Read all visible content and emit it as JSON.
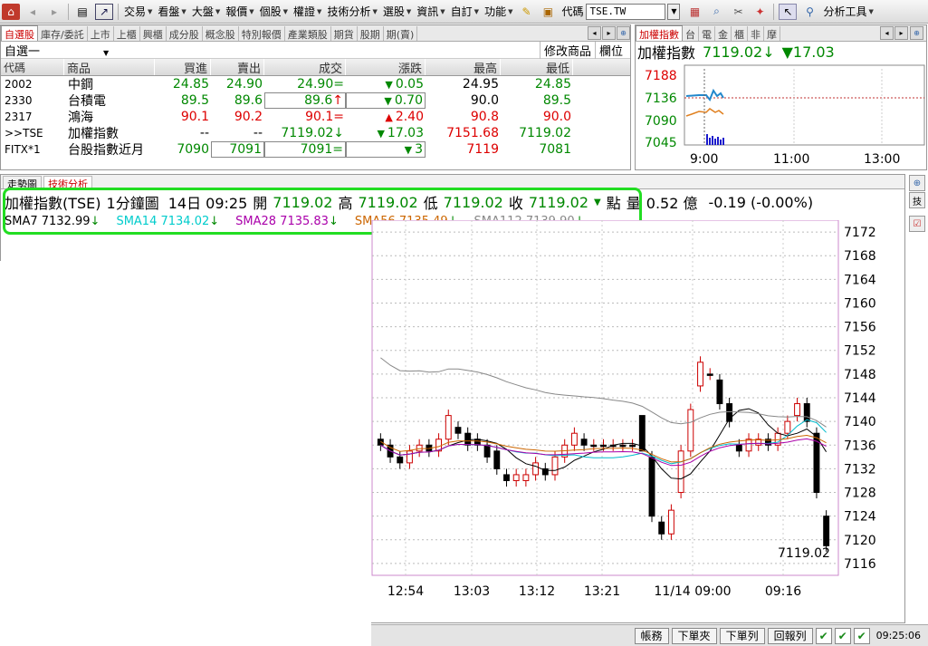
{
  "toolbar": {
    "menus": [
      "交易",
      "看盤",
      "大盤",
      "報價",
      "個股",
      "權證",
      "技術分析",
      "選股",
      "資訊",
      "自訂",
      "功能"
    ],
    "code_label": "代碼",
    "code_value": "TSE.TW",
    "analysis_tools": "分析工具"
  },
  "watchlist": {
    "tabs": [
      "自選股",
      "庫存/委託",
      "上市",
      "上櫃",
      "興櫃",
      "成分股",
      "概念股",
      "特別報價",
      "產業類股",
      "期貨",
      "股期",
      "期(賣)"
    ],
    "group_name": "自選一",
    "modify_label": "修改商品",
    "columns_label": "欄位",
    "headers": [
      "代碼",
      "商品",
      "買進",
      "賣出",
      "成交",
      "漲跌",
      "最高",
      "最低"
    ],
    "rows": [
      {
        "code": "2002",
        "name": "中鋼",
        "bid": "24.85",
        "ask": "24.90",
        "last": "24.90",
        "last_mark": "=",
        "chg": "0.05",
        "chg_dir": "down",
        "high": "24.95",
        "low": "24.85",
        "color": "green"
      },
      {
        "code": "2330",
        "name": "台積電",
        "bid": "89.5",
        "ask": "89.6",
        "last": "89.6",
        "last_mark": "↑",
        "chg": "0.70",
        "chg_dir": "down",
        "high": "90.0",
        "low": "89.5",
        "color": "green"
      },
      {
        "code": "2317",
        "name": "鴻海",
        "bid": "90.1",
        "ask": "90.2",
        "last": "90.1",
        "last_mark": "=",
        "chg": "2.40",
        "chg_dir": "up",
        "high": "90.8",
        "low": "90.0",
        "color": "red"
      },
      {
        "code": ">>TSE",
        "name": "加權指數",
        "bid": "--",
        "ask": "--",
        "last": "7119.02",
        "last_mark": "↓",
        "chg": "17.03",
        "chg_dir": "down",
        "high": "7151.68",
        "low": "7119.02",
        "color": "green"
      },
      {
        "code": "FITX*1",
        "name": "台股指數近月",
        "bid": "7090",
        "ask": "7091",
        "last": "7091",
        "last_mark": "=",
        "chg": "3",
        "chg_dir": "down",
        "high": "7119",
        "low": "7081",
        "color": "green"
      }
    ]
  },
  "mini_chart": {
    "tabs": [
      "加權指數",
      "台",
      "電",
      "金",
      "櫃",
      "非",
      "摩"
    ],
    "name": "加權指數",
    "value": "7119.02",
    "change": "17.03",
    "y_ticks": [
      "7188",
      "7136",
      "7090",
      "7045"
    ],
    "x_ticks": [
      "9:00",
      "11:00",
      "13:00"
    ]
  },
  "main_chart": {
    "tabs": [
      "走勢圖",
      "技術分析"
    ],
    "info": {
      "symbol": "加權指數(TSE)",
      "interval": "1分鐘圖",
      "date": "14日 09:25",
      "open_label": "開",
      "open": "7119.02",
      "high_label": "高",
      "high": "7119.02",
      "low_label": "低",
      "low": "7119.02",
      "close_label": "收",
      "close": "7119.02",
      "pts_label": "點",
      "volume_label": "量",
      "volume": "0.52 億",
      "change": "-0.19 (-0.00%)"
    },
    "ma": [
      {
        "label": "SMA7 7132.99",
        "color": "#000000"
      },
      {
        "label": "SMA14 7134.02",
        "color": "#00cccc"
      },
      {
        "label": "SMA28 7135.83",
        "color": "#aa00aa"
      },
      {
        "label": "SMA56 7135.49",
        "color": "#cc6600"
      },
      {
        "label": "SMA112 7139.90",
        "color": "#888888"
      }
    ],
    "last_price_label": "7119.02"
  },
  "chart_data": {
    "type": "candlestick",
    "y_ticks": [
      7172,
      7168,
      7164,
      7160,
      7156,
      7152,
      7148,
      7144,
      7140,
      7136,
      7132,
      7128,
      7124,
      7120,
      7116
    ],
    "ylim": [
      7114,
      7174
    ],
    "x_ticks": [
      "12:54",
      "13:03",
      "13:12",
      "13:21",
      "11/14 09:00",
      "09:16"
    ],
    "candles": [
      {
        "o": 7137,
        "c": 7136,
        "h": 7138,
        "l": 7135
      },
      {
        "o": 7136,
        "c": 7134,
        "h": 7137,
        "l": 7133
      },
      {
        "o": 7134,
        "c": 7133,
        "h": 7135,
        "l": 7132
      },
      {
        "o": 7133,
        "c": 7135,
        "h": 7136,
        "l": 7132
      },
      {
        "o": 7135,
        "c": 7136,
        "h": 7137,
        "l": 7134
      },
      {
        "o": 7136,
        "c": 7135,
        "h": 7137,
        "l": 7134
      },
      {
        "o": 7135,
        "c": 7137,
        "h": 7138,
        "l": 7134
      },
      {
        "o": 7137,
        "c": 7141,
        "h": 7142,
        "l": 7136
      },
      {
        "o": 7139,
        "c": 7138,
        "h": 7140,
        "l": 7137
      },
      {
        "o": 7138,
        "c": 7136,
        "h": 7139,
        "l": 7135
      },
      {
        "o": 7137,
        "c": 7136,
        "h": 7138,
        "l": 7135
      },
      {
        "o": 7136,
        "c": 7134,
        "h": 7137,
        "l": 7133
      },
      {
        "o": 7135,
        "c": 7132,
        "h": 7136,
        "l": 7131
      },
      {
        "o": 7131,
        "c": 7130,
        "h": 7132,
        "l": 7129
      },
      {
        "o": 7130,
        "c": 7131,
        "h": 7132,
        "l": 7129
      },
      {
        "o": 7130,
        "c": 7131,
        "h": 7132,
        "l": 7129
      },
      {
        "o": 7131,
        "c": 7133,
        "h": 7134,
        "l": 7130
      },
      {
        "o": 7132,
        "c": 7131,
        "h": 7133,
        "l": 7130
      },
      {
        "o": 7131,
        "c": 7134,
        "h": 7135,
        "l": 7130
      },
      {
        "o": 7134,
        "c": 7136,
        "h": 7137,
        "l": 7133
      },
      {
        "o": 7136,
        "c": 7138,
        "h": 7139,
        "l": 7135
      },
      {
        "o": 7137,
        "c": 7136,
        "h": 7138,
        "l": 7135
      },
      {
        "o": 7136,
        "c": 7136,
        "h": 7137,
        "l": 7135
      },
      {
        "o": 7136,
        "c": 7136,
        "h": 7137,
        "l": 7135
      },
      {
        "o": 7136,
        "c": 7136,
        "h": 7137,
        "l": 7135
      },
      {
        "o": 7136,
        "c": 7136,
        "h": 7137,
        "l": 7135
      },
      {
        "o": 7136,
        "c": 7136,
        "h": 7137,
        "l": 7135
      },
      {
        "o": 7141,
        "c": 7135,
        "h": 7141,
        "l": 7135
      },
      {
        "o": 7134,
        "c": 7124,
        "h": 7135,
        "l": 7123
      },
      {
        "o": 7123,
        "c": 7121,
        "h": 7124,
        "l": 7120
      },
      {
        "o": 7121,
        "c": 7125,
        "h": 7126,
        "l": 7120
      },
      {
        "o": 7128,
        "c": 7135,
        "h": 7136,
        "l": 7127
      },
      {
        "o": 7135,
        "c": 7142,
        "h": 7143,
        "l": 7134
      },
      {
        "o": 7146,
        "c": 7150,
        "h": 7151,
        "l": 7145
      },
      {
        "o": 7148,
        "c": 7148,
        "h": 7149,
        "l": 7147
      },
      {
        "o": 7147,
        "c": 7143,
        "h": 7148,
        "l": 7142
      },
      {
        "o": 7143,
        "c": 7140,
        "h": 7144,
        "l": 7139
      },
      {
        "o": 7136,
        "c": 7135,
        "h": 7137,
        "l": 7134
      },
      {
        "o": 7135,
        "c": 7137,
        "h": 7138,
        "l": 7134
      },
      {
        "o": 7136,
        "c": 7137,
        "h": 7138,
        "l": 7135
      },
      {
        "o": 7137,
        "c": 7136,
        "h": 7138,
        "l": 7135
      },
      {
        "o": 7136,
        "c": 7138,
        "h": 7139,
        "l": 7135
      },
      {
        "o": 7138,
        "c": 7140,
        "h": 7141,
        "l": 7137
      },
      {
        "o": 7141,
        "c": 7143,
        "h": 7144,
        "l": 7140
      },
      {
        "o": 7143,
        "c": 7140,
        "h": 7144,
        "l": 7139
      },
      {
        "o": 7138,
        "c": 7128,
        "h": 7139,
        "l": 7127
      },
      {
        "o": 7124,
        "c": 7119,
        "h": 7125,
        "l": 7118
      }
    ]
  },
  "status_bar": {
    "buttons": [
      "帳務",
      "下單夾",
      "下單列",
      "回報列"
    ],
    "time": "09:25:06"
  }
}
